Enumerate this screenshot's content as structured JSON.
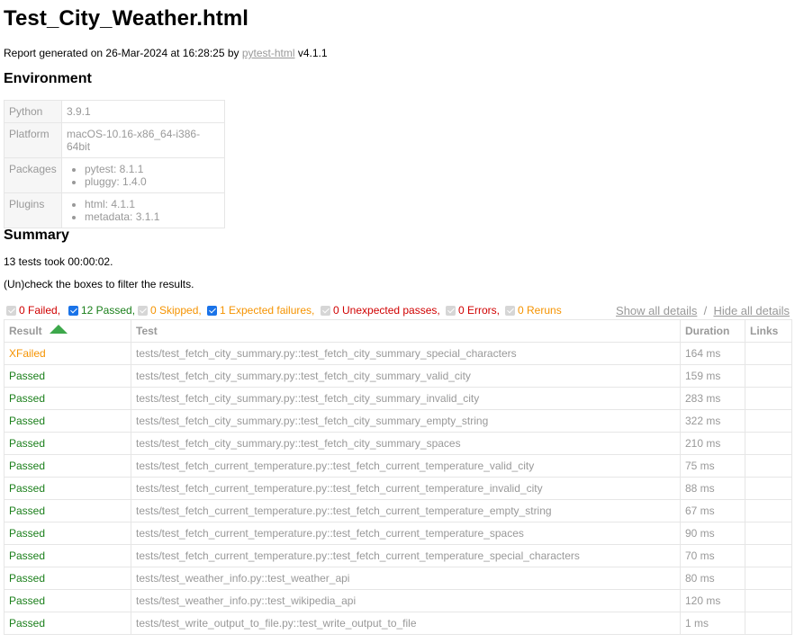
{
  "title": "Test_City_Weather.html",
  "generated": {
    "prefix": "Report generated on 26-Mar-2024 at 16:28:25 by ",
    "link": "pytest-html",
    "suffix": " v4.1.1"
  },
  "environment": {
    "heading": "Environment",
    "python_label": "Python",
    "python_value": "3.9.1",
    "platform_label": "Platform",
    "platform_value": "macOS-10.16-x86_64-i386-64bit",
    "packages_label": "Packages",
    "packages": [
      "pytest: 8.1.1",
      "pluggy: 1.4.0"
    ],
    "plugins_label": "Plugins",
    "plugins": [
      "html: 4.1.1",
      "metadata: 3.1.1"
    ]
  },
  "summary": {
    "heading": "Summary",
    "took": "13 tests took 00:00:02.",
    "filter_note": "(Un)check the boxes to filter the results."
  },
  "filters": {
    "failed": "0 Failed,",
    "passed": "12 Passed,",
    "skipped": "0 Skipped,",
    "xfailed": "1 Expected failures,",
    "xpassed": "0 Unexpected passes,",
    "errors": "0 Errors,",
    "reruns": "0 Reruns"
  },
  "details": {
    "show": "Show all details",
    "sep": "/",
    "hide": "Hide all details"
  },
  "results": {
    "headers": {
      "result": "Result",
      "test": "Test",
      "duration": "Duration",
      "links": "Links"
    },
    "rows": [
      {
        "result": "XFailed",
        "test": "tests/test_fetch_city_summary.py::test_fetch_city_summary_special_characters",
        "duration": "164 ms"
      },
      {
        "result": "Passed",
        "test": "tests/test_fetch_city_summary.py::test_fetch_city_summary_valid_city",
        "duration": "159 ms"
      },
      {
        "result": "Passed",
        "test": "tests/test_fetch_city_summary.py::test_fetch_city_summary_invalid_city",
        "duration": "283 ms"
      },
      {
        "result": "Passed",
        "test": "tests/test_fetch_city_summary.py::test_fetch_city_summary_empty_string",
        "duration": "322 ms"
      },
      {
        "result": "Passed",
        "test": "tests/test_fetch_city_summary.py::test_fetch_city_summary_spaces",
        "duration": "210 ms"
      },
      {
        "result": "Passed",
        "test": "tests/test_fetch_current_temperature.py::test_fetch_current_temperature_valid_city",
        "duration": "75 ms"
      },
      {
        "result": "Passed",
        "test": "tests/test_fetch_current_temperature.py::test_fetch_current_temperature_invalid_city",
        "duration": "88 ms"
      },
      {
        "result": "Passed",
        "test": "tests/test_fetch_current_temperature.py::test_fetch_current_temperature_empty_string",
        "duration": "67 ms"
      },
      {
        "result": "Passed",
        "test": "tests/test_fetch_current_temperature.py::test_fetch_current_temperature_spaces",
        "duration": "90 ms"
      },
      {
        "result": "Passed",
        "test": "tests/test_fetch_current_temperature.py::test_fetch_current_temperature_special_characters",
        "duration": "70 ms"
      },
      {
        "result": "Passed",
        "test": "tests/test_weather_info.py::test_weather_api",
        "duration": "80 ms"
      },
      {
        "result": "Passed",
        "test": "tests/test_weather_info.py::test_wikipedia_api",
        "duration": "120 ms"
      },
      {
        "result": "Passed",
        "test": "tests/test_write_output_to_file.py::test_write_output_to_file",
        "duration": "1 ms"
      }
    ]
  }
}
